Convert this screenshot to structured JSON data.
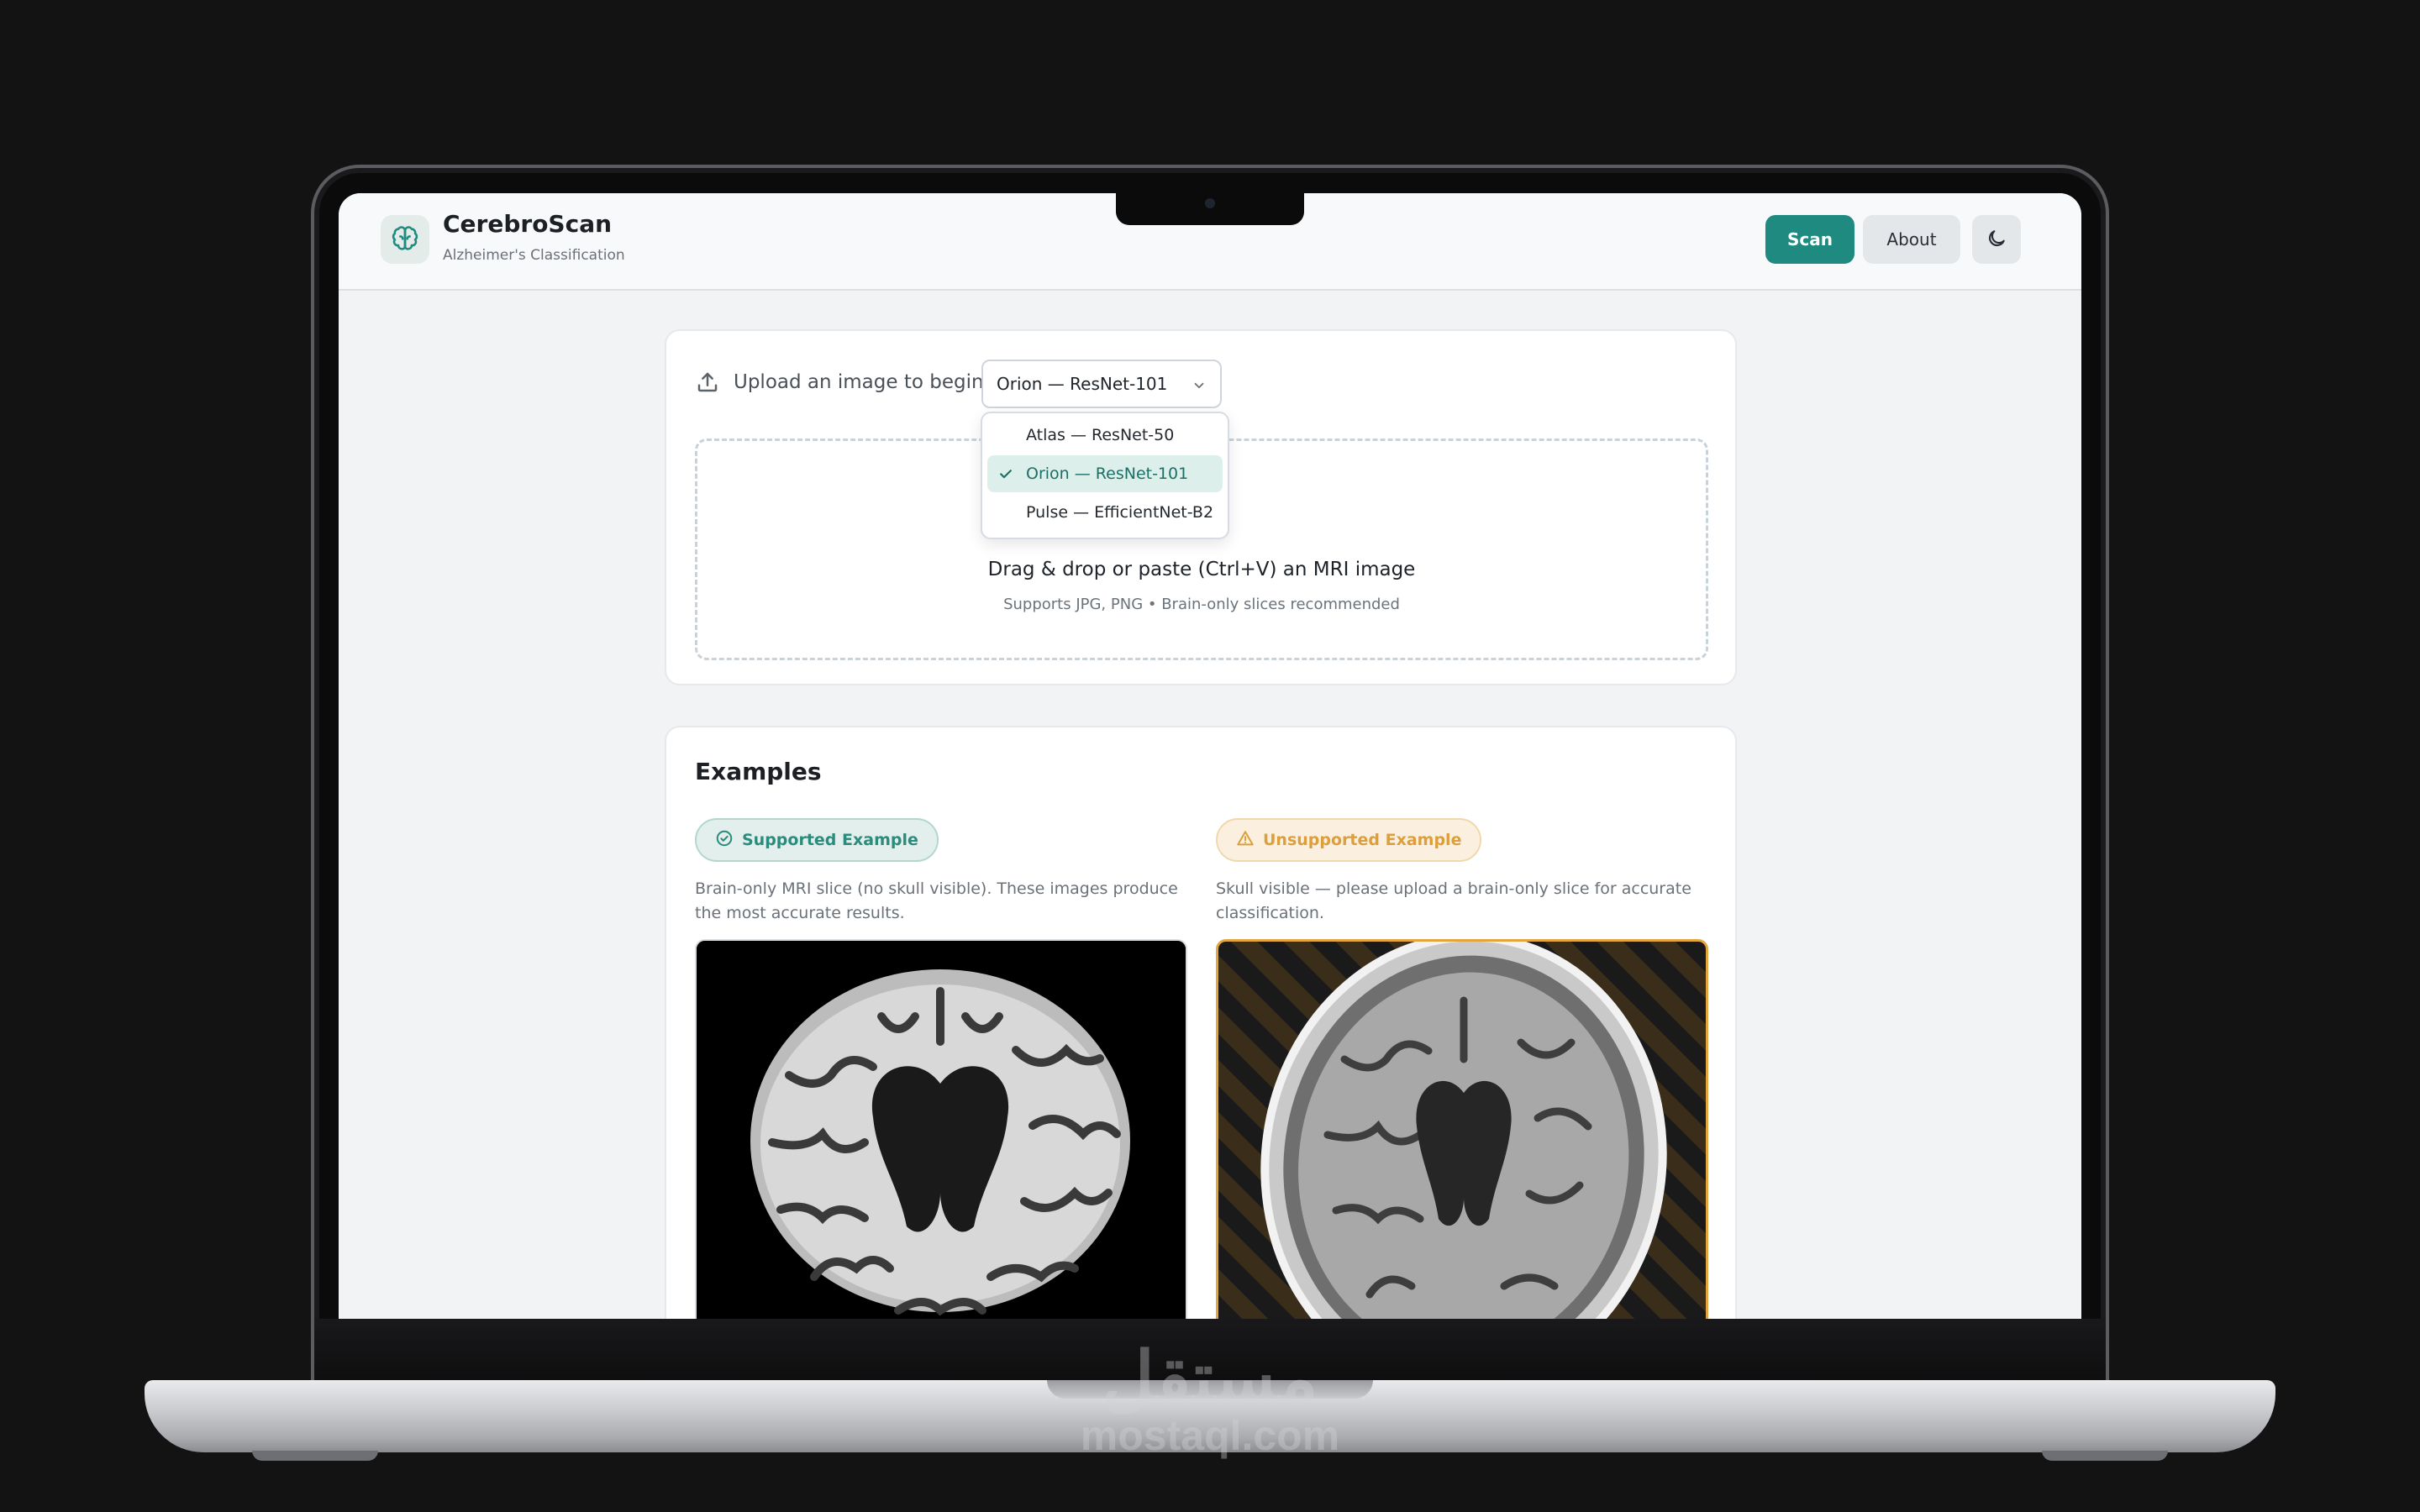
{
  "app": {
    "title": "CerebroScan",
    "subtitle": "Alzheimer's Classification",
    "logo_icon": "brain-icon"
  },
  "nav": {
    "scan_label": "Scan",
    "about_label": "About",
    "theme_icon": "moon-icon"
  },
  "upload": {
    "prompt": "Upload an image to begin",
    "icon": "upload-icon",
    "selected_model": "Orion — ResNet-101",
    "dropzone_title": "Drag & drop or paste (Ctrl+V) an MRI image",
    "dropzone_hint": "Supports JPG, PNG • Brain-only slices recommended"
  },
  "model_options": [
    {
      "label": "Atlas — ResNet-50",
      "selected": false
    },
    {
      "label": "Orion — ResNet-101",
      "selected": true
    },
    {
      "label": "Pulse — EfficientNet-B2",
      "selected": false
    }
  ],
  "examples": {
    "title": "Examples",
    "supported": {
      "badge": "Supported Example",
      "description": "Brain-only MRI slice (no skull visible). These images produce the most accurate results."
    },
    "unsupported": {
      "badge": "Unsupported Example",
      "description": "Skull visible — please upload a brain-only slice for accurate classification."
    }
  },
  "watermark": {
    "arabic": "مستقل",
    "site": "mostaql.com"
  },
  "colors": {
    "accent": "#1f8a7f",
    "warning": "#dc9f3c",
    "background": "#f1f3f5",
    "frame": "#131313"
  }
}
